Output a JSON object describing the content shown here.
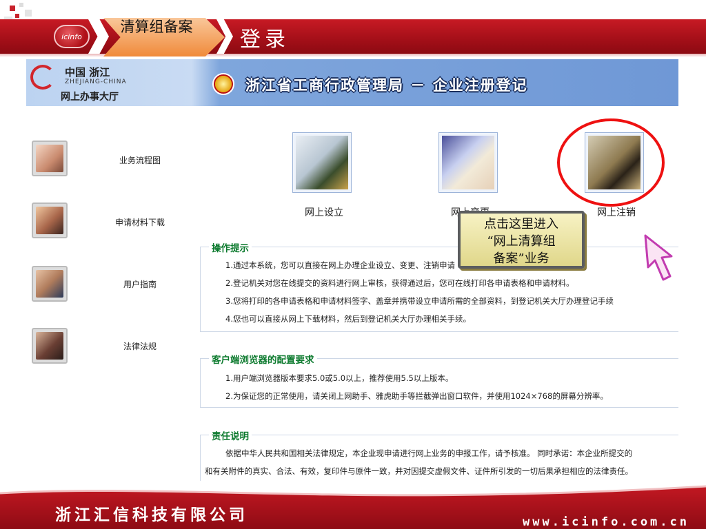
{
  "header": {
    "logo_text": "icinfo",
    "tag": "清算组备案",
    "title": "登录"
  },
  "banner": {
    "brand_line1": "中国 浙江",
    "brand_line2": "ZHEJIANG-CHINA",
    "brand_line3": "网上办事大厅",
    "title": "浙江省工商行政管理局 － 企业注册登记"
  },
  "sidebar": {
    "items": [
      {
        "label": "业务流程图",
        "icon": "hand-writing-photo-icon"
      },
      {
        "label": "申请材料下载",
        "icon": "phone-call-photo-icon"
      },
      {
        "label": "用户指南",
        "icon": "businessman-photo-icon"
      },
      {
        "label": "法律法规",
        "icon": "businesswoman-photo-icon"
      }
    ]
  },
  "actions": [
    {
      "label": "网上设立",
      "icon": "fountain-pen-photo-icon"
    },
    {
      "label": "网上变更",
      "icon": "hands-documents-photo-icon"
    },
    {
      "label": "网上注销",
      "icon": "pen-writing-photo-icon"
    }
  ],
  "sections": {
    "tips": {
      "title": "操作提示",
      "lines": [
        "1.通过本系统，您可以直接在网上办理企业设立、变更、注销申请",
        "2.登记机关对您在线提交的资料进行网上审核，获得通过后，您可在线打印各申请表格和申请材料。",
        "3.您将打印的各申请表格和申请材料签字、盖章并携带设立申请所需的全部资料，到登记机关大厅办理登记手续",
        "4.您也可以直接从网上下载材料，然后到登记机关大厅办理相关手续。"
      ]
    },
    "browser": {
      "title": "客户端浏览器的配置要求",
      "lines": [
        "1.用户端浏览器版本要求5.0或5.0以上，推荐使用5.5以上版本。",
        "2.为保证您的正常使用，请关闭上网助手、雅虎助手等拦截弹出窗口软件，并使用1024×768的屏幕分辨率。"
      ]
    },
    "liability": {
      "title": "责任说明",
      "lines": [
        "依据中华人民共和国相关法律规定，本企业现申请进行网上业务的申报工作，请予核准。 同时承诺：本企业所提交的",
        "和有关附件的真实、合法、有效，复印件与原件一致，并对因提交虚假文件、证件所引发的一切后果承担相应的法律责任。"
      ]
    }
  },
  "callout": {
    "lines": [
      "点击这里进入",
      "“网上清算组",
      "备案”业务"
    ]
  },
  "footer": {
    "company": "浙江汇信科技有限公司",
    "url": "www.icinfo.com.cn"
  },
  "colors": {
    "header_red": "#b0121b",
    "section_title_green": "#0c7a2e",
    "banner_blue": "#6f98d6",
    "highlight_ring": "#e11111"
  }
}
